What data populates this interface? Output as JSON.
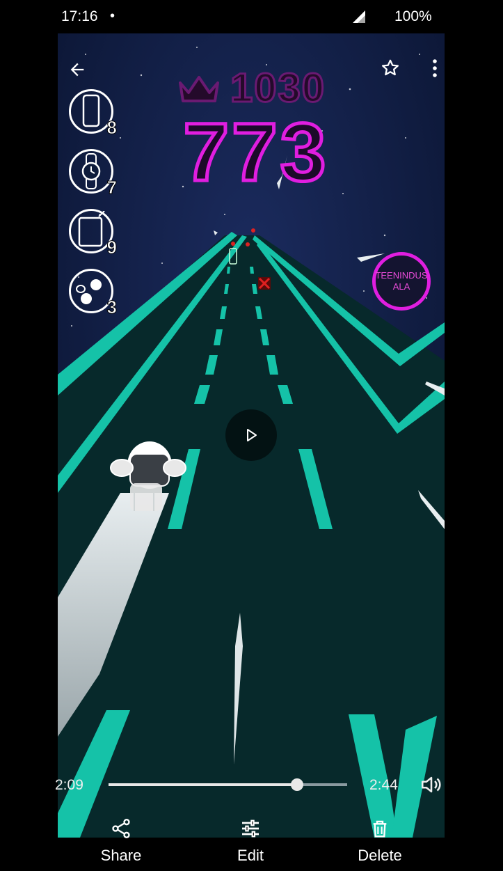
{
  "status_bar": {
    "time": "17:16",
    "dot": "•",
    "battery": "100%"
  },
  "game": {
    "best_score": "1030",
    "score": "773",
    "sign_line1": "TEENINDUS",
    "sign_line2": "ALA",
    "items": [
      {
        "icon": "phone-icon",
        "count": "8"
      },
      {
        "icon": "watch-icon",
        "count": "7"
      },
      {
        "icon": "tablet-icon",
        "count": "9"
      },
      {
        "icon": "earbuds-icon",
        "count": "3"
      }
    ]
  },
  "player": {
    "elapsed": "2:09",
    "total": "2:44",
    "progress": 0.79
  },
  "actions": {
    "share": "Share",
    "edit": "Edit",
    "delete": "Delete"
  },
  "colors": {
    "road_edge": "#15c2a8",
    "neon_magenta": "#e01ee0",
    "road": "#07292b",
    "sky": "#0e1b3b"
  }
}
